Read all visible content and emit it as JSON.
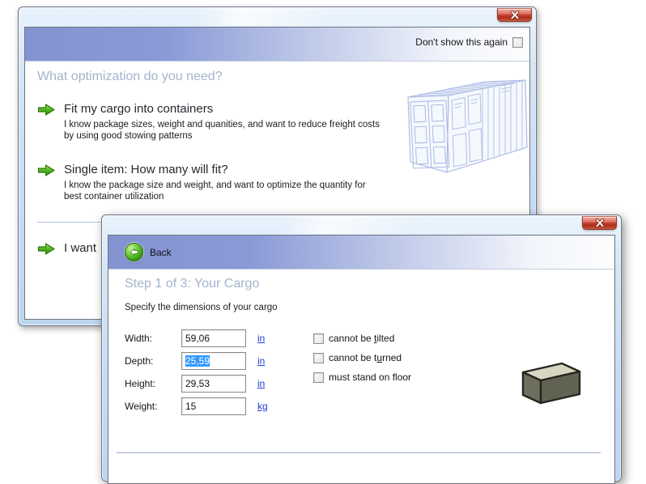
{
  "colors": {
    "header_band_blue": "#8a9ad6",
    "heading_text": "#a3b5cc",
    "link_blue": "#1e3bd2",
    "selection_blue": "#3399ff",
    "close_button_red": "#c6422f",
    "arrow_green": "#4aa81e",
    "watermark_blue": "#a9b9e3"
  },
  "optimization_window": {
    "dont_show_label": "Don't show this again",
    "heading": "What optimization do you need?",
    "options": [
      {
        "title": "Fit my cargo into containers",
        "desc1": "I know package sizes, weight and quanities, and want to reduce freight costs",
        "desc2": "by using good stowing patterns"
      },
      {
        "title": "Single item: How many will fit?",
        "desc1": "I know the package size and weight, and want to optimize the quantity for",
        "desc2": "best container utilization"
      },
      {
        "title": "I want",
        "desc1": "",
        "desc2": ""
      }
    ]
  },
  "cargo_window": {
    "back_label": "Back",
    "heading": "Step 1 of 3: Your Cargo",
    "instruction": "Specify the dimensions of your cargo",
    "fields": [
      {
        "label": "Width:",
        "value": "59,06",
        "unit": "in",
        "selected": false
      },
      {
        "label": "Depth:",
        "value": "25,59",
        "unit": "in",
        "selected": true
      },
      {
        "label": "Height:",
        "value": "29,53",
        "unit": "in",
        "selected": false
      },
      {
        "label": "Weight:",
        "value": "15",
        "unit": "kg",
        "selected": false
      }
    ],
    "constraints": [
      {
        "pre": "cannot be ",
        "key": "t",
        "post": "ilted",
        "checked": false
      },
      {
        "pre": "cannot be t",
        "key": "u",
        "post": "rned",
        "checked": false
      },
      {
        "pre": "must stand on floor",
        "key": "",
        "post": "",
        "checked": false
      }
    ]
  }
}
